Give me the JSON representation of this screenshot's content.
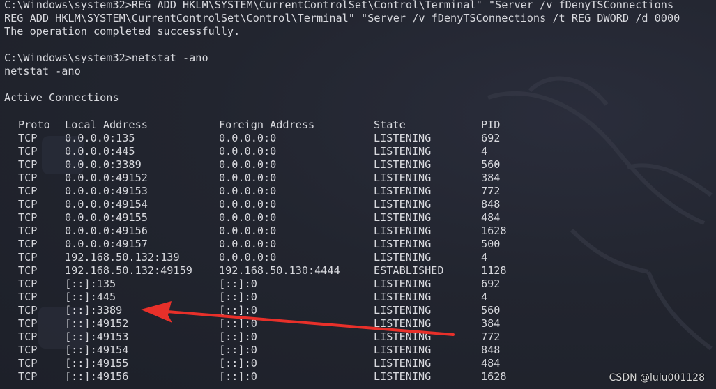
{
  "terminal": {
    "lines": [
      "C:\\Windows\\system32>REG ADD HKLM\\SYSTEM\\CurrentControlSet\\Control\\Terminal\" \"Server /v fDenyTSConnections",
      "REG ADD HKLM\\SYSTEM\\CurrentControlSet\\Control\\Terminal\" \"Server /v fDenyTSConnections /t REG_DWORD /d 0000",
      "The operation completed successfully.",
      "",
      "C:\\Windows\\system32>netstat -ano",
      "netstat -ano",
      "",
      "Active Connections"
    ],
    "headers": {
      "proto": "Proto",
      "local": "Local Address",
      "foreign": "Foreign Address",
      "state": "State",
      "pid": "PID"
    },
    "rows": [
      {
        "proto": "TCP",
        "local": "0.0.0.0:135",
        "foreign": "0.0.0.0:0",
        "state": "LISTENING",
        "pid": "692"
      },
      {
        "proto": "TCP",
        "local": "0.0.0.0:445",
        "foreign": "0.0.0.0:0",
        "state": "LISTENING",
        "pid": "4"
      },
      {
        "proto": "TCP",
        "local": "0.0.0.0:3389",
        "foreign": "0.0.0.0:0",
        "state": "LISTENING",
        "pid": "560"
      },
      {
        "proto": "TCP",
        "local": "0.0.0.0:49152",
        "foreign": "0.0.0.0:0",
        "state": "LISTENING",
        "pid": "384"
      },
      {
        "proto": "TCP",
        "local": "0.0.0.0:49153",
        "foreign": "0.0.0.0:0",
        "state": "LISTENING",
        "pid": "772"
      },
      {
        "proto": "TCP",
        "local": "0.0.0.0:49154",
        "foreign": "0.0.0.0:0",
        "state": "LISTENING",
        "pid": "848"
      },
      {
        "proto": "TCP",
        "local": "0.0.0.0:49155",
        "foreign": "0.0.0.0:0",
        "state": "LISTENING",
        "pid": "484"
      },
      {
        "proto": "TCP",
        "local": "0.0.0.0:49156",
        "foreign": "0.0.0.0:0",
        "state": "LISTENING",
        "pid": "1628"
      },
      {
        "proto": "TCP",
        "local": "0.0.0.0:49157",
        "foreign": "0.0.0.0:0",
        "state": "LISTENING",
        "pid": "500"
      },
      {
        "proto": "TCP",
        "local": "192.168.50.132:139",
        "foreign": "0.0.0.0:0",
        "state": "LISTENING",
        "pid": "4"
      },
      {
        "proto": "TCP",
        "local": "192.168.50.132:49159",
        "foreign": "192.168.50.130:4444",
        "state": "ESTABLISHED",
        "pid": "1128"
      },
      {
        "proto": "TCP",
        "local": "[::]:135",
        "foreign": "[::]:0",
        "state": "LISTENING",
        "pid": "692"
      },
      {
        "proto": "TCP",
        "local": "[::]:445",
        "foreign": "[::]:0",
        "state": "LISTENING",
        "pid": "4"
      },
      {
        "proto": "TCP",
        "local": "[::]:3389",
        "foreign": "[::]:0",
        "state": "LISTENING",
        "pid": "560"
      },
      {
        "proto": "TCP",
        "local": "[::]:49152",
        "foreign": "[::]:0",
        "state": "LISTENING",
        "pid": "384"
      },
      {
        "proto": "TCP",
        "local": "[::]:49153",
        "foreign": "[::]:0",
        "state": "LISTENING",
        "pid": "772"
      },
      {
        "proto": "TCP",
        "local": "[::]:49154",
        "foreign": "[::]:0",
        "state": "LISTENING",
        "pid": "848"
      },
      {
        "proto": "TCP",
        "local": "[::]:49155",
        "foreign": "[::]:0",
        "state": "LISTENING",
        "pid": "484"
      },
      {
        "proto": "TCP",
        "local": "[::]:49156",
        "foreign": "[::]:0",
        "state": "LISTENING",
        "pid": "1628"
      }
    ],
    "colors": {
      "background": "#22252f",
      "text": "#d8d9de",
      "arrow": "#e8302a"
    }
  },
  "annotation": {
    "arrow_icon": "red-arrow-icon",
    "highlighted_row": "[::]:3389"
  },
  "watermark": {
    "text": "CSDN @lulu001128"
  }
}
